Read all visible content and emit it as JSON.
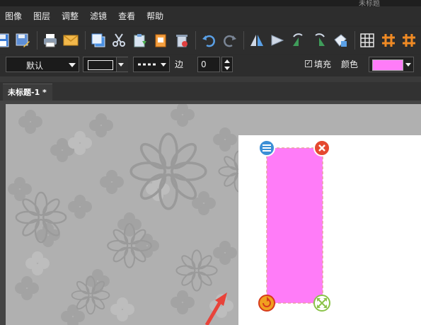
{
  "window": {
    "title_partial": "未标题"
  },
  "menu": [
    "图像",
    "图层",
    "调整",
    "滤镜",
    "查看",
    "帮助"
  ],
  "toolbar": {
    "icons": [
      "save-icon",
      "save-as-icon",
      "print-icon",
      "email-icon",
      "copy-icon",
      "cut-icon",
      "paste-icon",
      "paste-new-icon",
      "delete-icon",
      "undo-icon",
      "redo-icon",
      "flip-horizontal-icon",
      "flip-vertical-icon",
      "rotate-left-icon",
      "rotate-right-icon",
      "cleanup-icon",
      "grid-icon",
      "hash-icon",
      "hash-alt-icon"
    ]
  },
  "props": {
    "style_value": "默认",
    "border_label": "边",
    "border_value": "0",
    "fill_label": "填充",
    "fill_checked": true,
    "color_label": "颜色",
    "fill_color": "#ff7cf8"
  },
  "tabs": [
    {
      "label": "未标题-1 *"
    }
  ],
  "canvas": {
    "background": "#b0b0b0",
    "shape_color": "#ff7cf8",
    "arrow_color": "#e8433a"
  }
}
